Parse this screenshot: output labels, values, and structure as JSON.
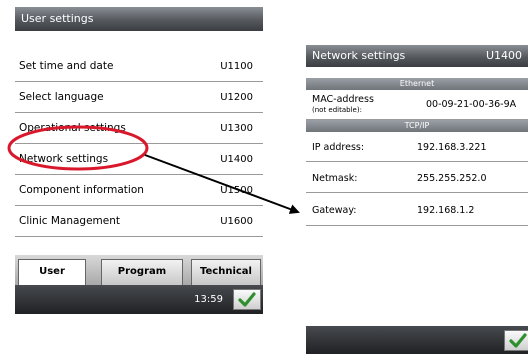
{
  "user_settings": {
    "title": "User settings",
    "items": [
      {
        "label": "Set time and date",
        "code": "U1100"
      },
      {
        "label": "Select language",
        "code": "U1200"
      },
      {
        "label": "Operational settings",
        "code": "U1300"
      },
      {
        "label": "Network settings",
        "code": "U1400"
      },
      {
        "label": "Component information",
        "code": "U1500"
      },
      {
        "label": "Clinic Management",
        "code": "U1600"
      }
    ],
    "tabs": [
      {
        "label": "User",
        "active": true
      },
      {
        "label": "Program",
        "active": false
      },
      {
        "label": "Technical",
        "active": false
      }
    ],
    "time": "13:59",
    "ok_icon": "check-icon"
  },
  "network_settings": {
    "title": "Network settings",
    "code": "U1400",
    "ethernet_header": "Ethernet",
    "mac_label": "MAC-address",
    "mac_sublabel": "(not editable):",
    "mac_value": "00-09-21-00-36-9A",
    "tcpip_header": "TCP/IP",
    "ip_label": "IP address:",
    "ip_value": "192.168.3.221",
    "netmask_label": "Netmask:",
    "netmask_value": "255.255.252.0",
    "gateway_label": "Gateway:",
    "gateway_value": "192.168.1.2",
    "ok_icon": "check-icon"
  },
  "annotation": {
    "highlight_color": "#d9182b",
    "arrow_color": "#000000"
  }
}
